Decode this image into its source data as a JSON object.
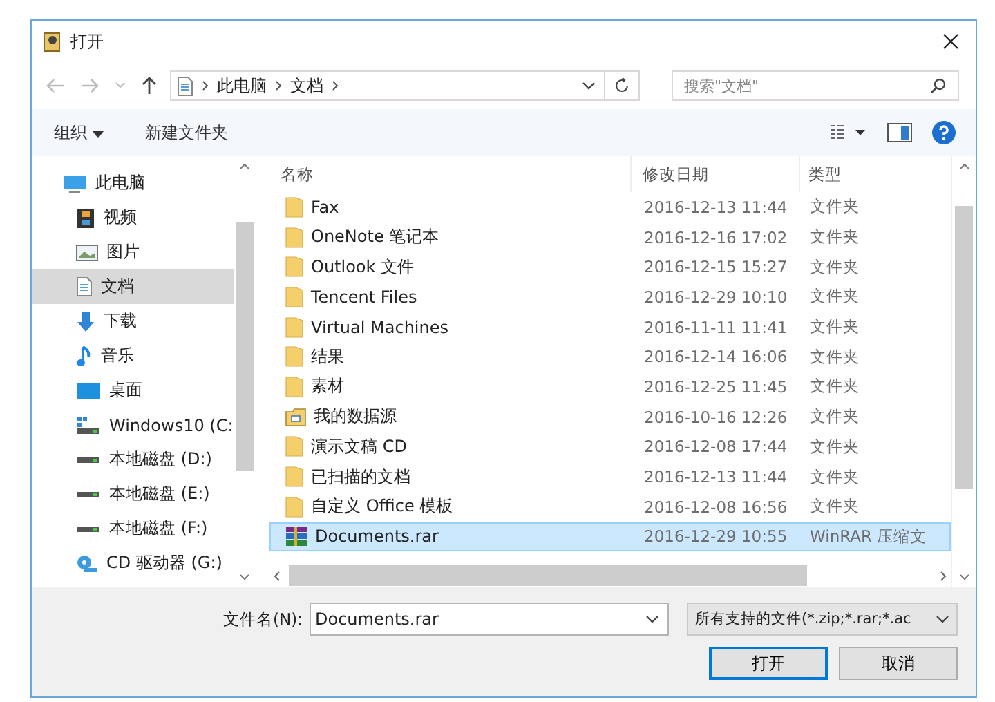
{
  "window": {
    "title": "打开"
  },
  "address": {
    "path": [
      "此电脑",
      "文档"
    ]
  },
  "search": {
    "placeholder": "搜索\"文档\""
  },
  "toolbar": {
    "organize": "组织",
    "new_folder": "新建文件夹"
  },
  "sidebar": {
    "items": [
      {
        "label": "此电脑",
        "kind": "pc",
        "selected": false
      },
      {
        "label": "视频",
        "kind": "video",
        "selected": false
      },
      {
        "label": "图片",
        "kind": "pictures",
        "selected": false
      },
      {
        "label": "文档",
        "kind": "documents",
        "selected": true
      },
      {
        "label": "下载",
        "kind": "downloads",
        "selected": false
      },
      {
        "label": "音乐",
        "kind": "music",
        "selected": false
      },
      {
        "label": "桌面",
        "kind": "desktop",
        "selected": false
      },
      {
        "label": "Windows10 (C:",
        "kind": "system-drive",
        "selected": false
      },
      {
        "label": "本地磁盘 (D:)",
        "kind": "drive",
        "selected": false
      },
      {
        "label": "本地磁盘 (E:)",
        "kind": "drive",
        "selected": false
      },
      {
        "label": "本地磁盘 (F:)",
        "kind": "drive",
        "selected": false
      },
      {
        "label": "CD 驱动器 (G:)",
        "kind": "cd",
        "selected": false
      }
    ]
  },
  "table": {
    "columns": [
      "名称",
      "修改日期",
      "类型"
    ],
    "rows": [
      {
        "name": "Fax",
        "date": "2016-12-13 11:44",
        "type": "文件夹",
        "kind": "folder",
        "selected": false
      },
      {
        "name": "OneNote 笔记本",
        "date": "2016-12-16 17:02",
        "type": "文件夹",
        "kind": "folder",
        "selected": false
      },
      {
        "name": "Outlook 文件",
        "date": "2016-12-15 15:27",
        "type": "文件夹",
        "kind": "folder",
        "selected": false
      },
      {
        "name": "Tencent Files",
        "date": "2016-12-29 10:10",
        "type": "文件夹",
        "kind": "folder",
        "selected": false
      },
      {
        "name": "Virtual Machines",
        "date": "2016-11-11 11:41",
        "type": "文件夹",
        "kind": "folder",
        "selected": false
      },
      {
        "name": "结果",
        "date": "2016-12-14 16:06",
        "type": "文件夹",
        "kind": "folder",
        "selected": false
      },
      {
        "name": "素材",
        "date": "2016-12-25 11:45",
        "type": "文件夹",
        "kind": "folder",
        "selected": false
      },
      {
        "name": "我的数据源",
        "date": "2016-10-16 12:26",
        "type": "文件夹",
        "kind": "data-folder",
        "selected": false
      },
      {
        "name": "演示文稿 CD",
        "date": "2016-12-08 17:44",
        "type": "文件夹",
        "kind": "folder",
        "selected": false
      },
      {
        "name": "已扫描的文档",
        "date": "2016-12-13 11:44",
        "type": "文件夹",
        "kind": "folder",
        "selected": false
      },
      {
        "name": "自定义 Office 模板",
        "date": "2016-12-08 16:56",
        "type": "文件夹",
        "kind": "folder",
        "selected": false
      },
      {
        "name": "Documents.rar",
        "date": "2016-12-29 10:55",
        "type": "WinRAR 压缩文",
        "kind": "archive",
        "selected": true
      }
    ]
  },
  "file_name": {
    "label": "文件名(N):",
    "value": "Documents.rar"
  },
  "filter": {
    "value": "所有支持的文件(*.zip;*.rar;*.ac"
  },
  "buttons": [
    "打开",
    "取消"
  ]
}
